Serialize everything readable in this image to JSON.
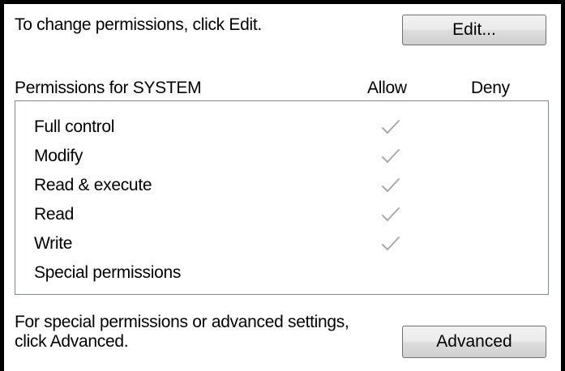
{
  "header": {
    "instruction": "To change permissions, click Edit.",
    "edit_label": "Edit..."
  },
  "permissions": {
    "heading": "Permissions for SYSTEM",
    "allow_column": "Allow",
    "deny_column": "Deny",
    "check_icon": "checkmark-icon",
    "check_color": "#a9a9a9",
    "rows": [
      {
        "label": "Full control",
        "allow": true,
        "deny": false
      },
      {
        "label": "Modify",
        "allow": true,
        "deny": false
      },
      {
        "label": "Read & execute",
        "allow": true,
        "deny": false
      },
      {
        "label": "Read",
        "allow": true,
        "deny": false
      },
      {
        "label": "Write",
        "allow": true,
        "deny": false
      },
      {
        "label": "Special permissions",
        "allow": false,
        "deny": false
      }
    ]
  },
  "footer": {
    "line1": "For special permissions or advanced settings,",
    "line2": "click Advanced.",
    "advanced_label": "Advanced"
  }
}
